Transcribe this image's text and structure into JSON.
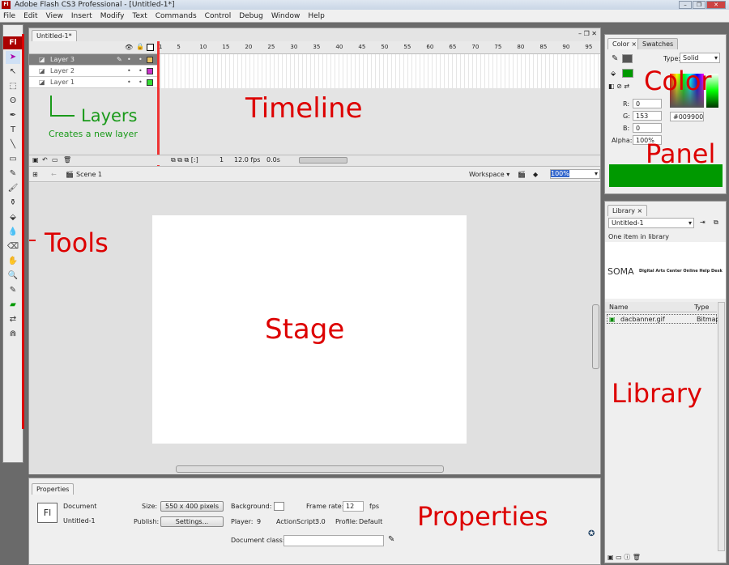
{
  "window": {
    "title": "Adobe Flash CS3 Professional - [Untitled-1*]",
    "logo": "Fl",
    "controls": [
      "minimize",
      "restore",
      "close"
    ]
  },
  "menu": [
    "File",
    "Edit",
    "View",
    "Insert",
    "Modify",
    "Text",
    "Commands",
    "Control",
    "Debug",
    "Window",
    "Help"
  ],
  "tools": {
    "logo": "Fl",
    "items": [
      "selection-icon",
      "subselection-icon",
      "free-transform-icon",
      "lasso-icon",
      "pen-icon",
      "text-icon",
      "line-icon",
      "rectangle-icon",
      "pencil-icon",
      "brush-icon",
      "ink-bottle-icon",
      "paint-bucket-icon",
      "eyedropper-icon",
      "eraser-icon",
      "hand-icon",
      "zoom-icon",
      "stroke-color-icon",
      "fill-color-icon",
      "swap-colors-icon",
      "snap-icon"
    ],
    "stroke_color": "#333333",
    "fill_color": "#009900"
  },
  "document": {
    "tab": "Untitled-1*"
  },
  "timeline": {
    "frame_numbers": [
      "1",
      "5",
      "10",
      "15",
      "20",
      "25",
      "30",
      "35",
      "40",
      "45",
      "50",
      "55",
      "60",
      "65",
      "70",
      "75",
      "80",
      "85",
      "90",
      "95"
    ],
    "layers": [
      {
        "name": "Layer 3",
        "color": "#e8c060",
        "selected": true
      },
      {
        "name": "Layer 2",
        "color": "#cc33cc",
        "selected": false
      },
      {
        "name": "Layer 1",
        "color": "#33dd33",
        "selected": false
      }
    ],
    "current_frame": "1",
    "fps": "12.0 fps",
    "time": "0.0s"
  },
  "editbar": {
    "scene": "Scene 1",
    "workspace": "Workspace",
    "zoom": "100%"
  },
  "properties": {
    "tab": "Properties",
    "type": "Document",
    "name": "Untitled-1",
    "size_label": "Size:",
    "size": "550 x 400 pixels",
    "publish_label": "Publish:",
    "settings": "Settings...",
    "background_label": "Background:",
    "background_color": "#ffffff",
    "frame_rate_label": "Frame rate:",
    "frame_rate": "12",
    "fps": "fps",
    "player_label": "Player:",
    "player": "9",
    "as_label": "ActionScript:",
    "as": "3.0",
    "profile_label": "Profile:",
    "profile": "Default",
    "doc_class_label": "Document class:",
    "doc_class": ""
  },
  "color_panel": {
    "tabs": [
      "Color",
      "Swatches"
    ],
    "type_label": "Type:",
    "type": "Solid",
    "r_label": "R:",
    "r": "0",
    "g_label": "G:",
    "g": "153",
    "b_label": "B:",
    "b": "0",
    "alpha_label": "Alpha:",
    "alpha": "100%",
    "hex": "#009900",
    "swatch": "#009900"
  },
  "library": {
    "tab": "Library",
    "doc": "Untitled-1",
    "count": "One item in library",
    "preview_text": "SOMA",
    "preview_caption": "Digital Arts Center Online Help Desk",
    "col_name": "Name",
    "col_type": "Type",
    "items": [
      {
        "name": "dacbanner.gif",
        "type": "Bitmap"
      }
    ]
  },
  "annotations": {
    "layers": "Layers",
    "new_layer": "Creates a new layer",
    "timeline": "Timeline",
    "tools": "Tools",
    "stage": "Stage",
    "properties": "Properties",
    "color": "Color",
    "panel": "Panel",
    "library": "Library"
  }
}
